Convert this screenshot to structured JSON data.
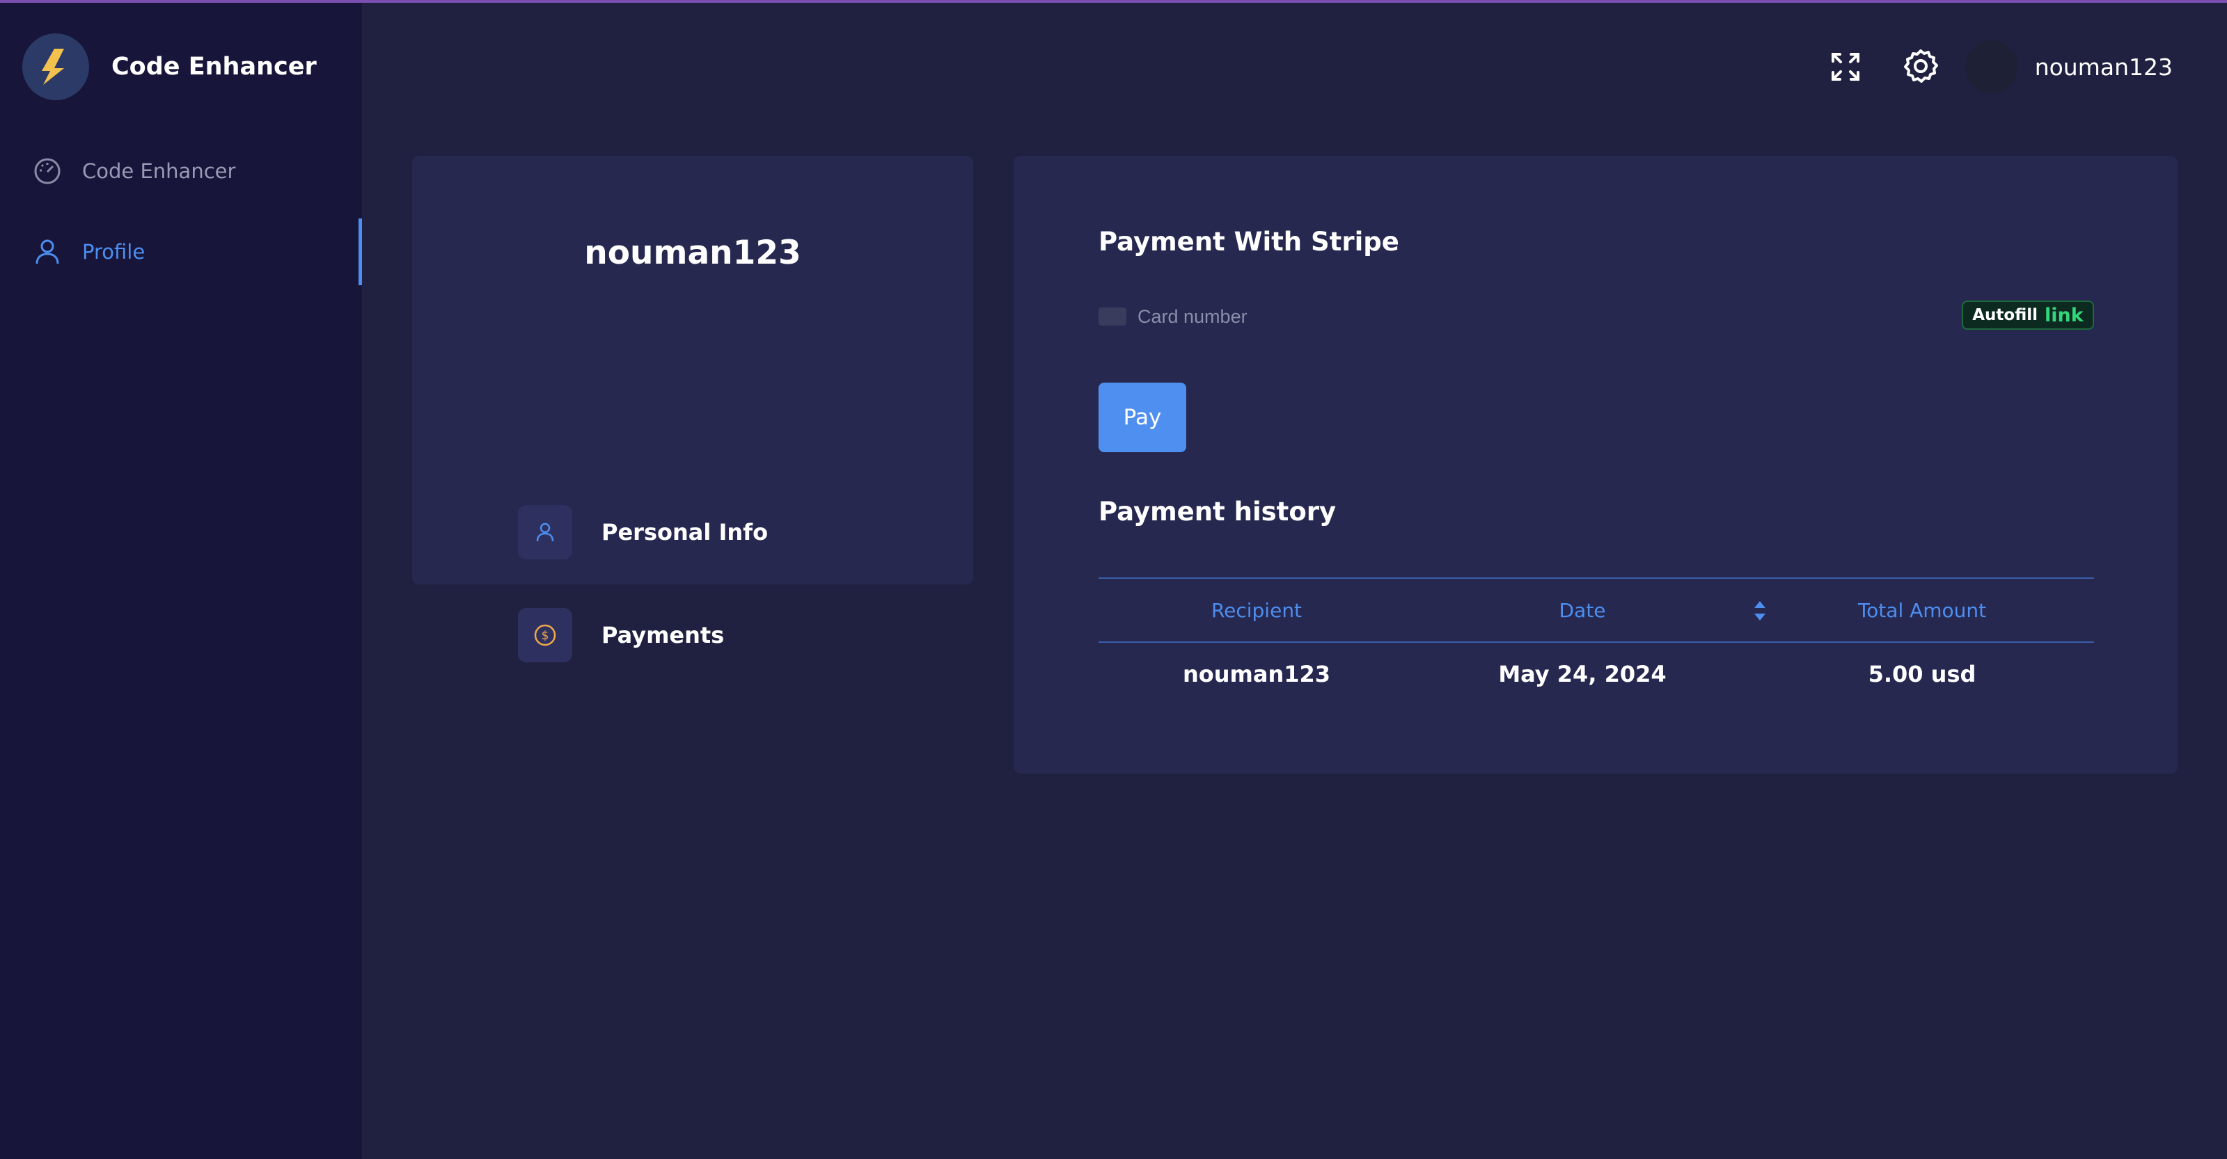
{
  "app": {
    "name": "Code Enhancer",
    "accent_color": "#4d8ef0"
  },
  "sidebar": {
    "items": [
      {
        "label": "Code Enhancer",
        "icon": "speedometer-icon",
        "active": false
      },
      {
        "label": "Profile",
        "icon": "user-icon",
        "active": true
      }
    ]
  },
  "header": {
    "fullscreen_icon": "fullscreen-icon",
    "settings_icon": "gear-icon",
    "username": "nouman123"
  },
  "profile": {
    "username": "nouman123",
    "menu": [
      {
        "label": "Personal Info",
        "icon": "user-icon"
      },
      {
        "label": "Payments",
        "icon": "dollar-coin-icon"
      }
    ]
  },
  "payment": {
    "title": "Payment With Stripe",
    "card_placeholder": "Card number",
    "autofill_text": "Autofill",
    "autofill_link": "link",
    "pay_label": "Pay"
  },
  "history": {
    "title": "Payment history",
    "columns": [
      "Recipient",
      "Date",
      "Total Amount"
    ],
    "rows": [
      {
        "recipient": "nouman123",
        "date": "May 24, 2024",
        "amount": "5.00 usd"
      }
    ]
  }
}
